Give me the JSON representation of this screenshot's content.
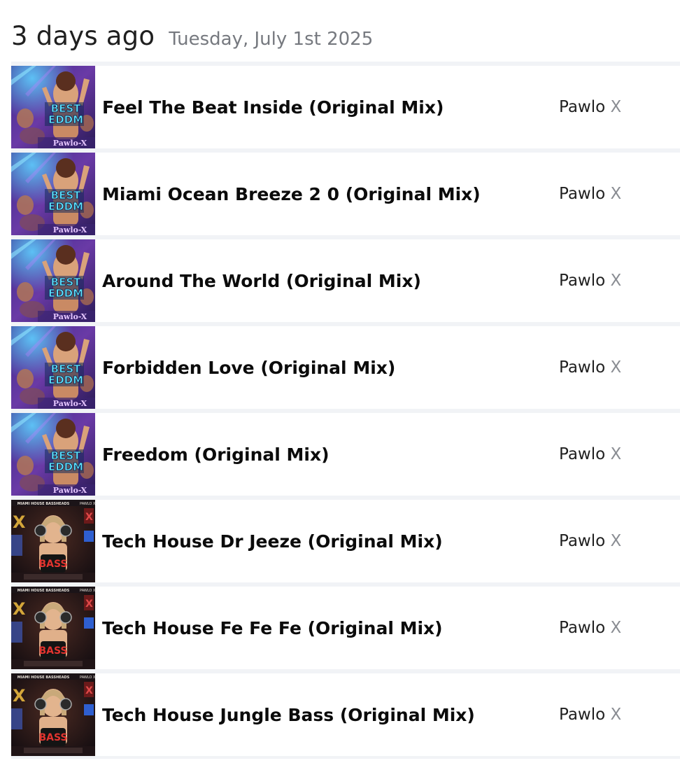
{
  "header": {
    "relative": "3 days ago",
    "date": "Tuesday, July 1st 2025"
  },
  "tracks": [
    {
      "title": "Feel The Beat Inside (Original Mix)",
      "artist_first": "Pawlo",
      "artist_last": "X",
      "cover": "best-eddm",
      "cover_text": [
        "BEST",
        "EDDM",
        "Pawlo-X"
      ]
    },
    {
      "title": "Miami Ocean Breeze 2 0 (Original Mix)",
      "artist_first": "Pawlo",
      "artist_last": "X",
      "cover": "best-eddm",
      "cover_text": [
        "BEST",
        "EDDM",
        "Pawlo-X"
      ]
    },
    {
      "title": "Around The World (Original Mix)",
      "artist_first": "Pawlo",
      "artist_last": "X",
      "cover": "best-eddm",
      "cover_text": [
        "BEST",
        "EDDM",
        "Pawlo-X"
      ]
    },
    {
      "title": "Forbidden Love (Original Mix)",
      "artist_first": "Pawlo",
      "artist_last": "X",
      "cover": "best-eddm",
      "cover_text": [
        "BEST",
        "EDDM",
        "Pawlo-X"
      ]
    },
    {
      "title": "Freedom (Original Mix)",
      "artist_first": "Pawlo",
      "artist_last": "X",
      "cover": "best-eddm",
      "cover_text": [
        "BEST",
        "EDDM",
        "Pawlo-X"
      ]
    },
    {
      "title": "Tech House Dr Jeeze (Original Mix)",
      "artist_first": "Pawlo",
      "artist_last": "X",
      "cover": "bass",
      "cover_text": [
        "MIAMI HOUSE BASSHEADS",
        "X",
        "BASS"
      ]
    },
    {
      "title": "Tech House Fe Fe Fe (Original Mix)",
      "artist_first": "Pawlo",
      "artist_last": "X",
      "cover": "bass",
      "cover_text": [
        "MIAMI HOUSE BASSHEADS",
        "X",
        "BASS"
      ]
    },
    {
      "title": "Tech House Jungle Bass (Original Mix)",
      "artist_first": "Pawlo",
      "artist_last": "X",
      "cover": "bass",
      "cover_text": [
        "MIAMI HOUSE BASSHEADS",
        "X",
        "BASS"
      ]
    }
  ]
}
